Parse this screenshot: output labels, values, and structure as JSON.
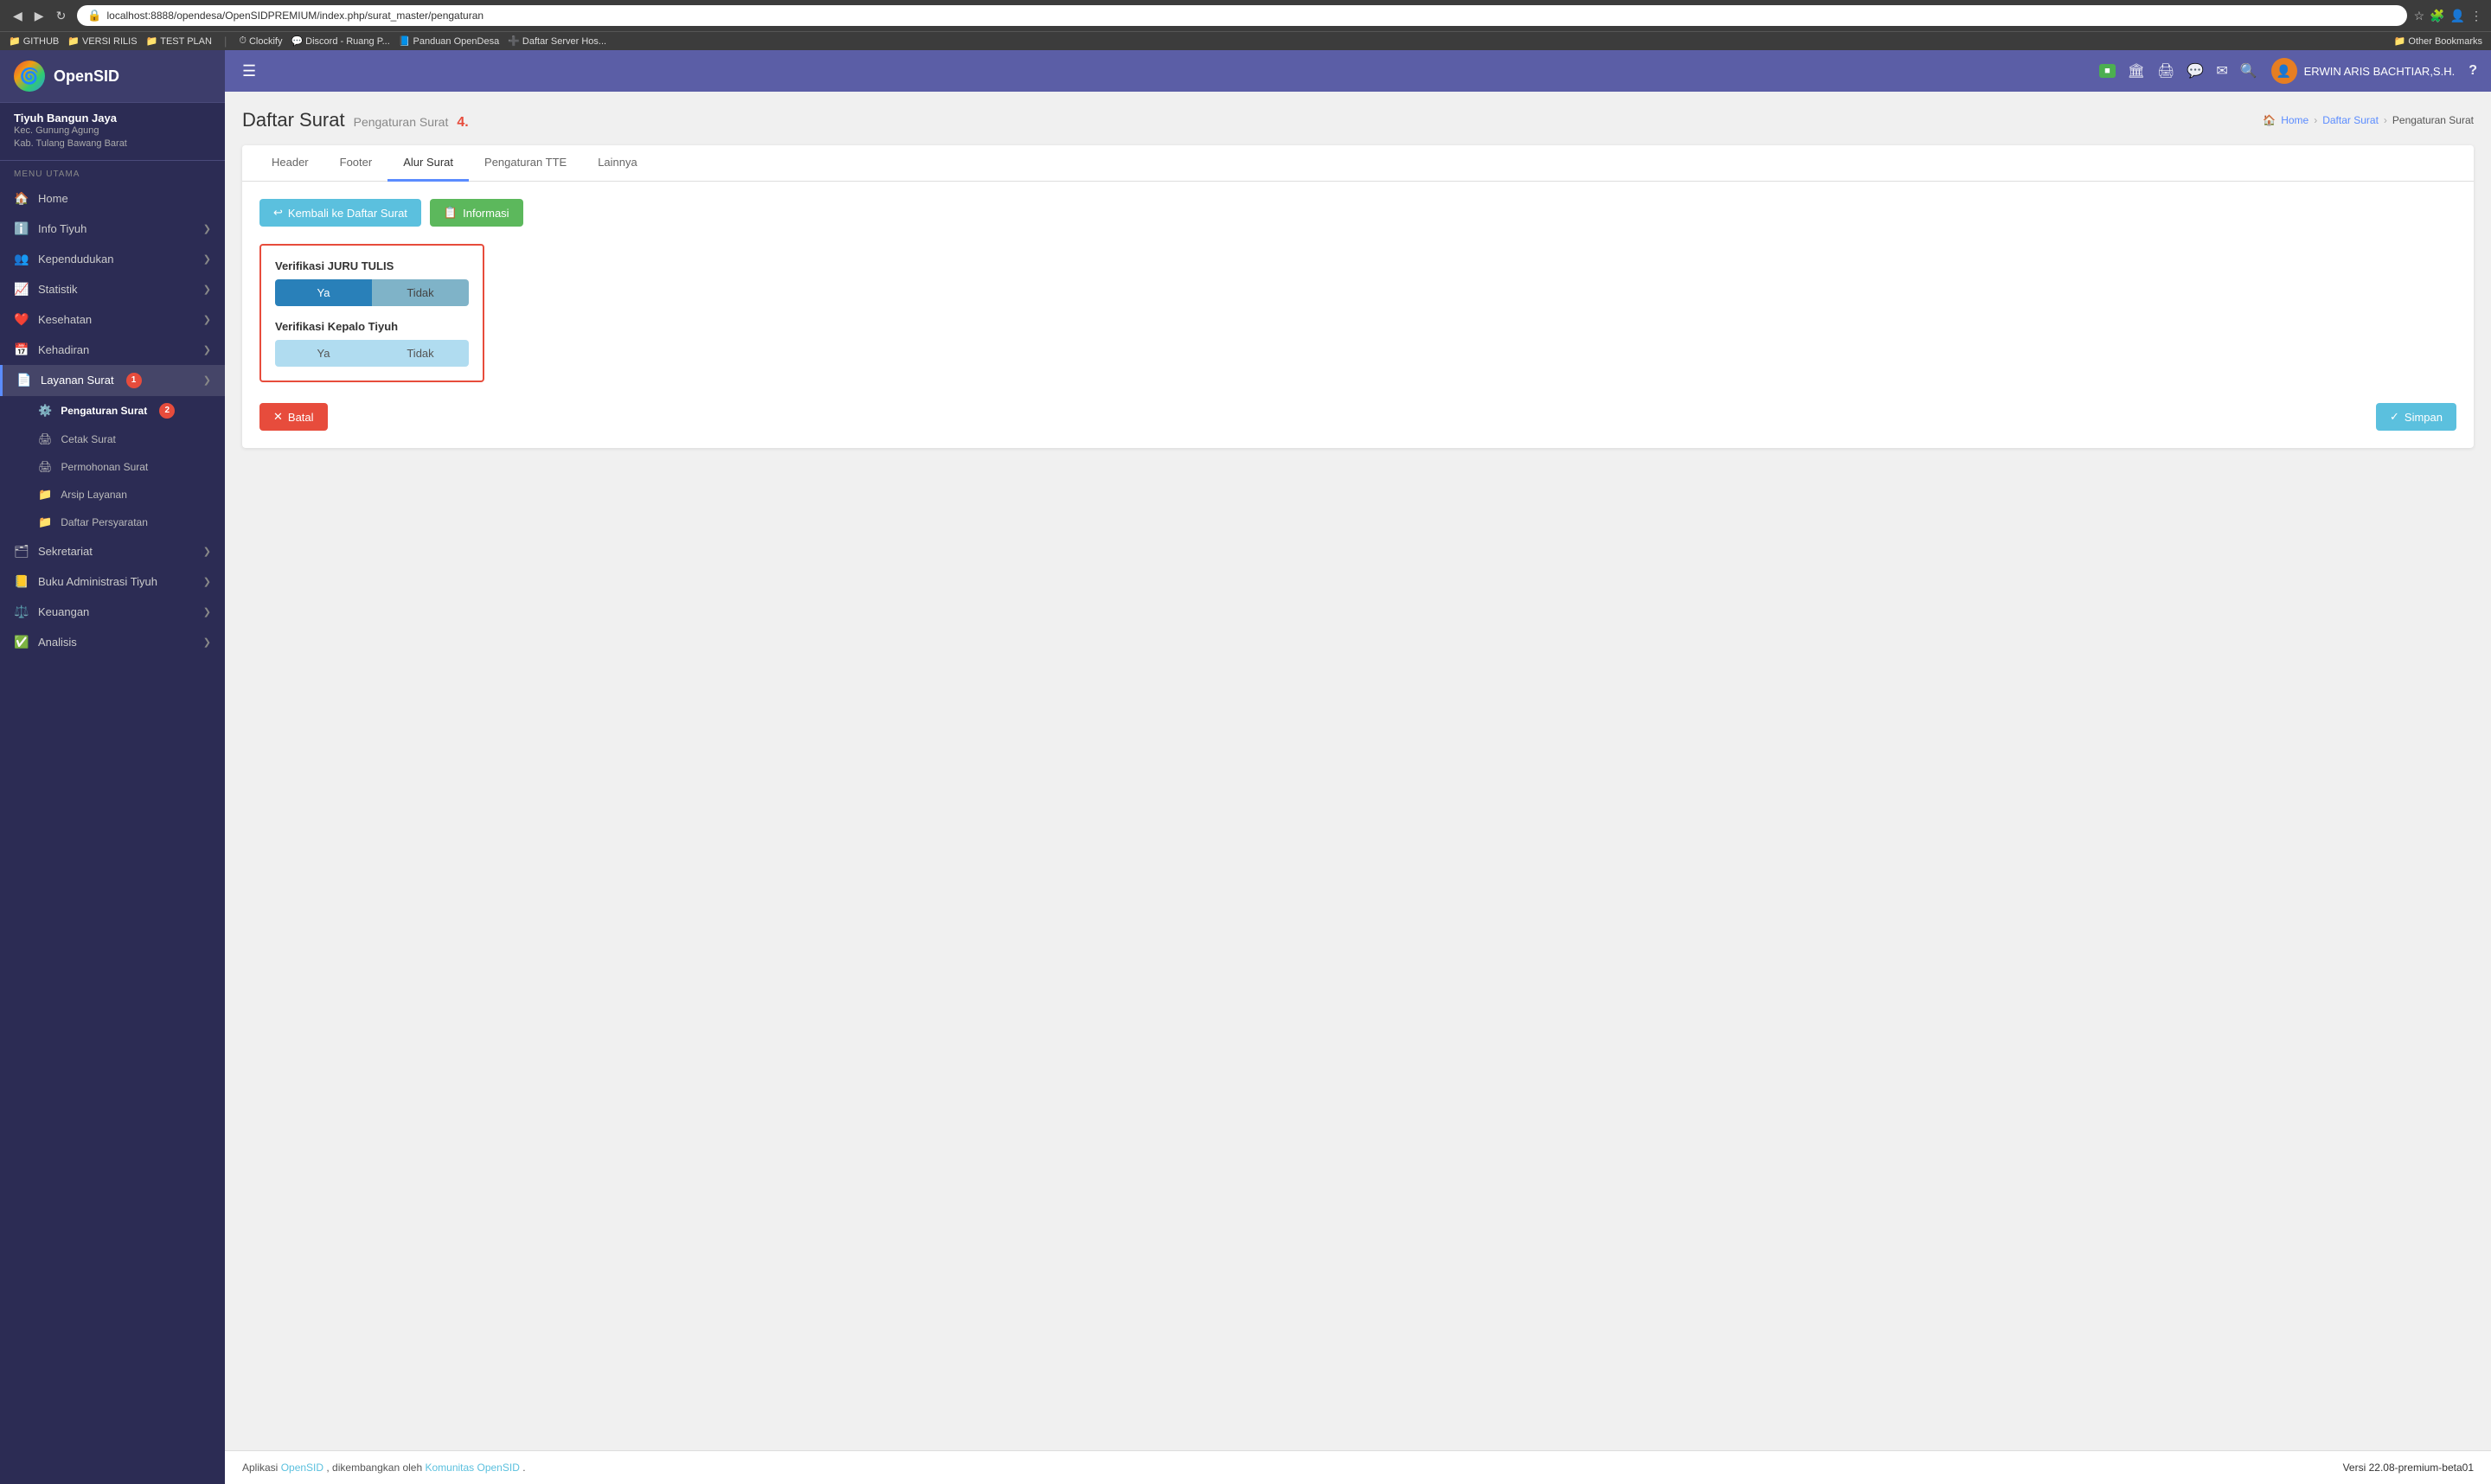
{
  "browser": {
    "url": "localhost:8888/opendesa/OpenSIDPREMIUM/index.php/surat_master/pengaturan",
    "nav_back": "◀",
    "nav_forward": "▶",
    "nav_refresh": "↻"
  },
  "bookmarks": [
    {
      "id": "github",
      "label": "GITHUB",
      "icon": "📁"
    },
    {
      "id": "versi-rilis",
      "label": "VERSI RILIS",
      "icon": "📁"
    },
    {
      "id": "test-plan",
      "label": "TEST PLAN",
      "icon": "📁"
    },
    {
      "id": "clockify",
      "label": "Clockify",
      "icon": "⏱"
    },
    {
      "id": "discord",
      "label": "Discord - Ruang P...",
      "icon": "💬"
    },
    {
      "id": "panduan",
      "label": "Panduan OpenDesa",
      "icon": "📘"
    },
    {
      "id": "daftar-server",
      "label": "Daftar Server Hos...",
      "icon": "➕"
    },
    {
      "id": "other-bookmarks",
      "label": "Other Bookmarks",
      "icon": "📁"
    }
  ],
  "brand": {
    "name": "OpenSID"
  },
  "org": {
    "name": "Tiyuh Bangun Jaya",
    "line1": "Kec. Gunung Agung",
    "line2": "Kab. Tulang Bawang Barat"
  },
  "menu": {
    "section_label": "MENU UTAMA",
    "items": [
      {
        "id": "home",
        "label": "Home",
        "icon": "🏠",
        "has_sub": false
      },
      {
        "id": "info-tiyuh",
        "label": "Info Tiyuh",
        "icon": "ℹ️",
        "has_sub": true
      },
      {
        "id": "kependudukan",
        "label": "Kependudukan",
        "icon": "👥",
        "has_sub": true
      },
      {
        "id": "statistik",
        "label": "Statistik",
        "icon": "📈",
        "has_sub": true
      },
      {
        "id": "kesehatan",
        "label": "Kesehatan",
        "icon": "❤️",
        "has_sub": true
      },
      {
        "id": "kehadiran",
        "label": "Kehadiran",
        "icon": "📅",
        "has_sub": true
      },
      {
        "id": "layanan-surat",
        "label": "Layanan Surat",
        "icon": "📄",
        "has_sub": true,
        "active": true
      },
      {
        "id": "sekretariat",
        "label": "Sekretariat",
        "icon": "🗂",
        "has_sub": true
      },
      {
        "id": "buku-admin",
        "label": "Buku Administrasi Tiyuh",
        "icon": "📒",
        "has_sub": true
      },
      {
        "id": "keuangan",
        "label": "Keuangan",
        "icon": "⚖️",
        "has_sub": true
      },
      {
        "id": "analisis",
        "label": "Analisis",
        "icon": "✅",
        "has_sub": true
      }
    ],
    "submenu": [
      {
        "id": "pengaturan-surat",
        "label": "Pengaturan Surat",
        "icon": "⚙️",
        "active": true
      },
      {
        "id": "cetak-surat",
        "label": "Cetak Surat",
        "icon": "🖨"
      },
      {
        "id": "permohonan-surat",
        "label": "Permohonan Surat",
        "icon": "🖨"
      },
      {
        "id": "arsip-layanan",
        "label": "Arsip Layanan",
        "icon": "📁"
      },
      {
        "id": "daftar-persyaratan",
        "label": "Daftar Persyaratan",
        "icon": "📁"
      }
    ]
  },
  "topbar": {
    "user_name": "ERWIN ARIS BACHTIAR,S.H.",
    "help_icon": "?",
    "icons": {
      "battery": "Battery",
      "building": "🏛",
      "print": "🖨",
      "chat": "💬",
      "mail": "✉",
      "search": "🔍"
    }
  },
  "page": {
    "title": "Daftar Surat",
    "subtitle": "Pengaturan Surat",
    "badge_numbers": {
      "layanan_surat": "1.",
      "pengaturan_surat": "2.",
      "tab_active": "4."
    }
  },
  "breadcrumb": {
    "home": "Home",
    "daftar_surat": "Daftar Surat",
    "current": "Pengaturan Surat"
  },
  "tabs": [
    {
      "id": "header",
      "label": "Header"
    },
    {
      "id": "footer",
      "label": "Footer"
    },
    {
      "id": "alur-surat",
      "label": "Alur Surat",
      "active": true
    },
    {
      "id": "pengaturan-tte",
      "label": "Pengaturan TTE"
    },
    {
      "id": "lainnya",
      "label": "Lainnya"
    }
  ],
  "buttons": {
    "back": "Kembali ke Daftar Surat",
    "info": "Informasi",
    "cancel": "Batal",
    "save": "Simpan"
  },
  "verifikasi": {
    "juru_tulis": {
      "label": "Verifikasi JURU TULIS",
      "ya": "Ya",
      "tidak": "Tidak",
      "selected": "ya"
    },
    "kepalo_tiyuh": {
      "label": "Verifikasi Kepalo Tiyuh",
      "ya": "Ya",
      "tidak": "Tidak",
      "selected": "tidak"
    }
  },
  "footer": {
    "app_text": "Aplikasi ",
    "app_name": "OpenSID",
    "middle_text": ", dikembangkan oleh ",
    "community_name": "Komunitas OpenSID",
    "end_text": ".",
    "version_label": "Versi ",
    "version_value": "22.08-premium-beta01"
  }
}
